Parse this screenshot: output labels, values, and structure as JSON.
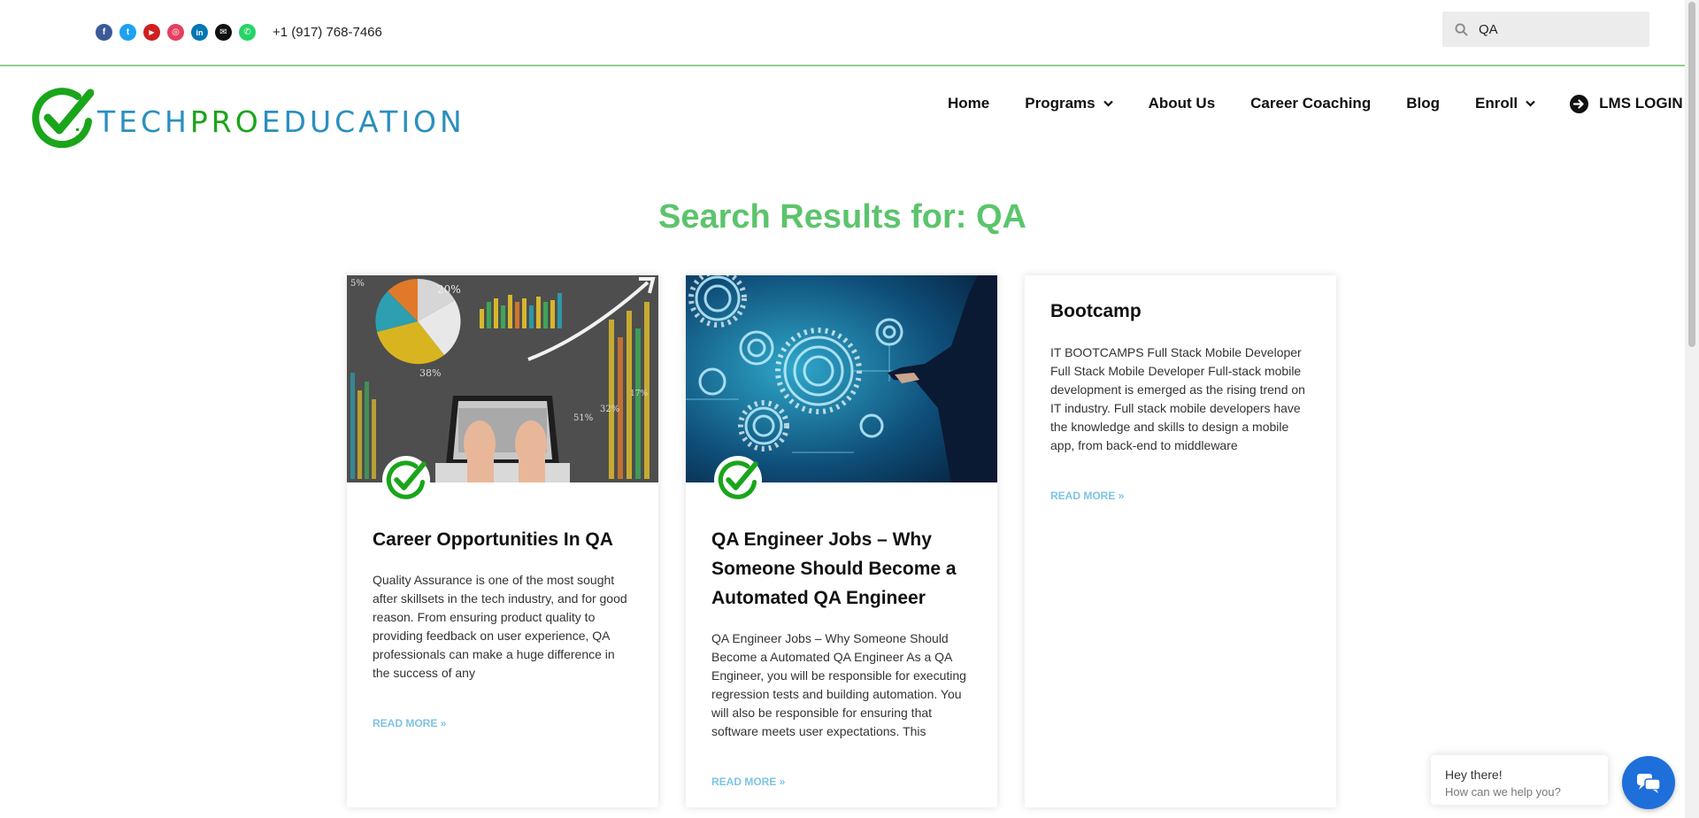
{
  "topbar": {
    "social_icons": [
      {
        "name": "facebook-icon",
        "color": "#3b5998",
        "glyph": "f"
      },
      {
        "name": "twitter-icon",
        "color": "#1da1f2",
        "glyph": "t"
      },
      {
        "name": "youtube-icon",
        "color": "#cd201f",
        "glyph": "▶"
      },
      {
        "name": "instagram-icon",
        "color": "#e4405f",
        "glyph": "◎"
      },
      {
        "name": "linkedin-icon",
        "color": "#0077b5",
        "glyph": "in"
      },
      {
        "name": "envelope-icon",
        "color": "#111111",
        "glyph": "✉"
      },
      {
        "name": "whatsapp-icon",
        "color": "#25d366",
        "glyph": "✆"
      }
    ],
    "phone": "+1 (917) 768-7466",
    "search": {
      "value": "QA",
      "icon": "search-icon"
    }
  },
  "header": {
    "logo": {
      "part1": "TECH",
      "part2": "PRO",
      "part3": "EDUCATION",
      "icon": "checkmark-logo-icon"
    },
    "nav": {
      "home": "Home",
      "programs": "Programs",
      "about": "About Us",
      "coaching": "Career Coaching",
      "blog": "Blog",
      "enroll": "Enroll",
      "lms": "LMS LOGIN"
    }
  },
  "main": {
    "title": "Search Results for: QA",
    "cards": [
      {
        "title": "Career Opportunities In QA",
        "excerpt": "Quality Assurance is one of the most sought after skillsets in the tech industry, and for good reason. From ensuring product quality to providing feedback on user experience, QA professionals can make a huge difference in the success of any",
        "read_more": "READ MORE »"
      },
      {
        "title": "QA Engineer Jobs – Why Someone Should Become a Automated QA Engineer",
        "excerpt": "QA Engineer Jobs – Why Someone Should Become a Automated QA Engineer As a QA Engineer, you will be responsible for executing regression tests and building automation. You will also be responsible for ensuring that software meets user expectations. This",
        "read_more": "READ MORE »"
      },
      {
        "title": "Bootcamp",
        "excerpt": "IT BOOTCAMPS Full Stack Mobile Developer Full Stack Mobile Developer Full-stack mobile development is emerged as the rising trend on IT industry. Full stack mobile developers have the knowledge and skills to design a mobile app, from back-end to middleware",
        "read_more": "READ MORE »"
      }
    ],
    "image_labels": {
      "a": "5%",
      "b": "20%",
      "c": "38%",
      "d": "32%",
      "e": "51%",
      "f": "17%"
    }
  },
  "chat": {
    "greeting": "Hey there!",
    "prompt": "How can we help you?"
  },
  "colors": {
    "accent_green": "#5cc46c",
    "logo_blue": "#2a8fbf",
    "logo_green": "#1aa51a",
    "link_blue": "#7ec3e6",
    "chat_blue": "#1e6fd9"
  }
}
